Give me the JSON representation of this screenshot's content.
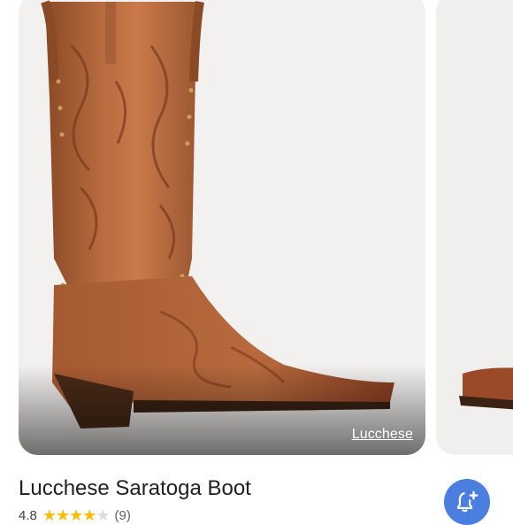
{
  "carousel": {
    "main_image": {
      "alt": "Brown embroidered western cowboy boot with studded trim",
      "source_label": "Lucchese"
    }
  },
  "product": {
    "title": "Lucchese Saratoga Boot",
    "rating": "4.8",
    "stars": "★★★★",
    "star_empty": "★",
    "review_count": "(9)"
  },
  "actions": {
    "price_alert_icon": "bell-plus-icon"
  },
  "colors": {
    "accent": "#4a7fe0",
    "star": "#fbbc04",
    "boot_leather": "#b0643a"
  }
}
